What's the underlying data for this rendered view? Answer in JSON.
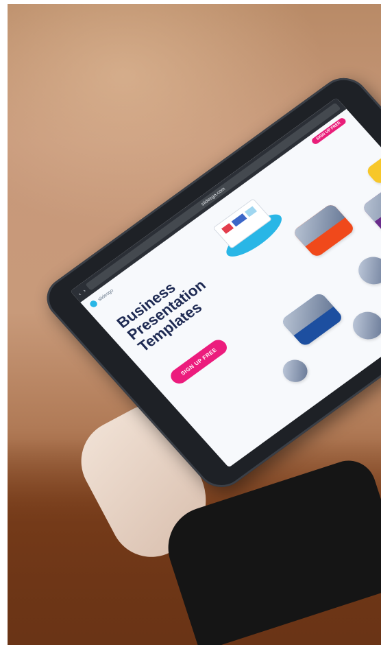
{
  "browser": {
    "url": "slidesgo.com",
    "back_glyph": "‹",
    "forward_glyph": "›"
  },
  "site": {
    "logo_text": "slidesgo",
    "top_cta_label": "SIGN UP FREE",
    "hero_title": "Business Presentation Templates",
    "hero_subtitle": "",
    "signup_label": "SIGN UP FREE"
  },
  "colors": {
    "brand_pink": "#ec1c7d",
    "brand_navy": "#1e2a53",
    "accent_blue": "#29b6e6"
  }
}
